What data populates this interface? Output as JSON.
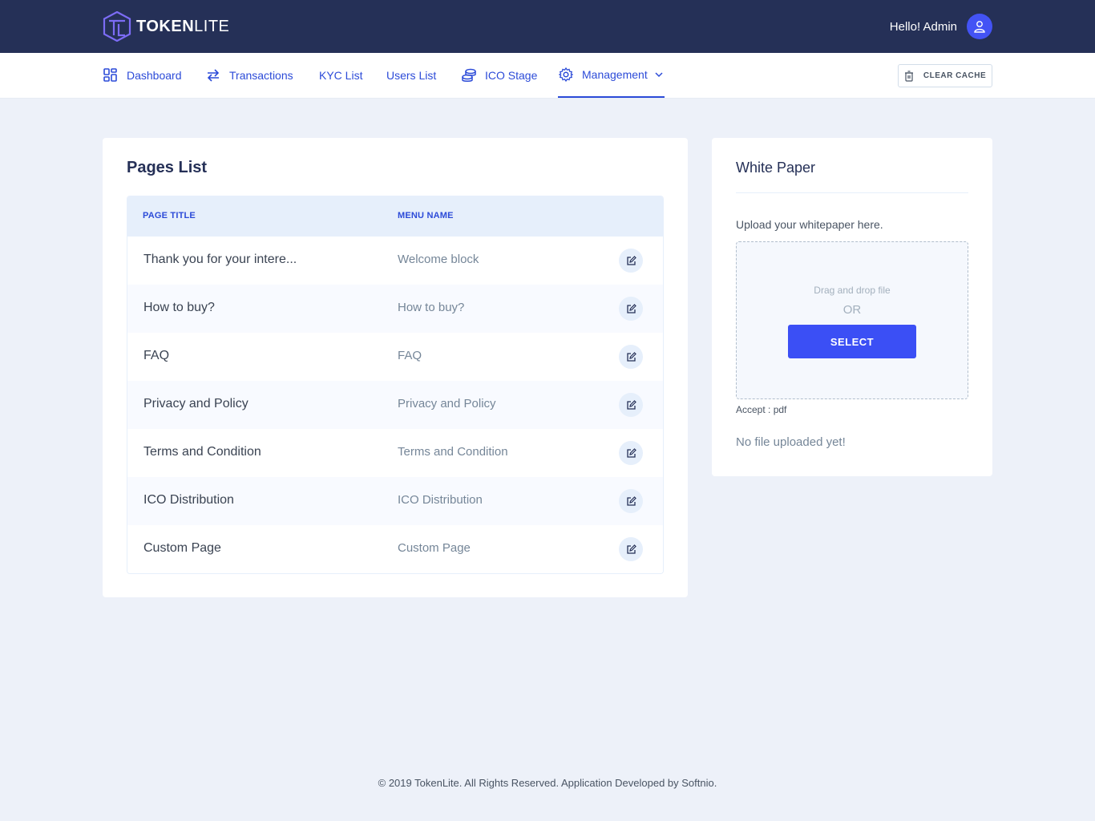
{
  "brand": {
    "bold": "TOKEN",
    "light": "LITE"
  },
  "header": {
    "greeting": "Hello! Admin"
  },
  "nav": {
    "items": [
      {
        "label": "Dashboard",
        "icon": "dashboard-icon"
      },
      {
        "label": "Transactions",
        "icon": "transfer-icon"
      },
      {
        "label": "KYC List"
      },
      {
        "label": "Users List"
      },
      {
        "label": "ICO Stage",
        "icon": "coins-icon"
      },
      {
        "label": "Management",
        "icon": "gear-icon",
        "active": true
      }
    ],
    "clear_cache": "CLEAR CACHE"
  },
  "pages": {
    "title": "Pages List",
    "columns": [
      "PAGE TITLE",
      "MENU NAME"
    ],
    "rows": [
      {
        "title": "Thank you for your intere...",
        "menu": "Welcome block"
      },
      {
        "title": "How to buy?",
        "menu": "How to buy?"
      },
      {
        "title": "FAQ",
        "menu": "FAQ"
      },
      {
        "title": "Privacy and Policy",
        "menu": "Privacy and Policy"
      },
      {
        "title": "Terms and Condition",
        "menu": "Terms and Condition"
      },
      {
        "title": "ICO Distribution",
        "menu": "ICO Distribution"
      },
      {
        "title": "Custom Page",
        "menu": "Custom Page"
      }
    ]
  },
  "whitepaper": {
    "title": "White Paper",
    "upload_label": "Upload your whitepaper here.",
    "drag_text": "Drag and drop file",
    "or_text": "OR",
    "select_label": "SELECT",
    "accept": "Accept : pdf",
    "status": "No file uploaded yet!"
  },
  "footer": {
    "text": "© 2019 TokenLite. All Rights Reserved. Application Developed by Softnio."
  },
  "colors": {
    "topbar": "#253057",
    "accent": "#2c4bd8",
    "button": "#3b4ff5",
    "background": "#edf1f9"
  }
}
